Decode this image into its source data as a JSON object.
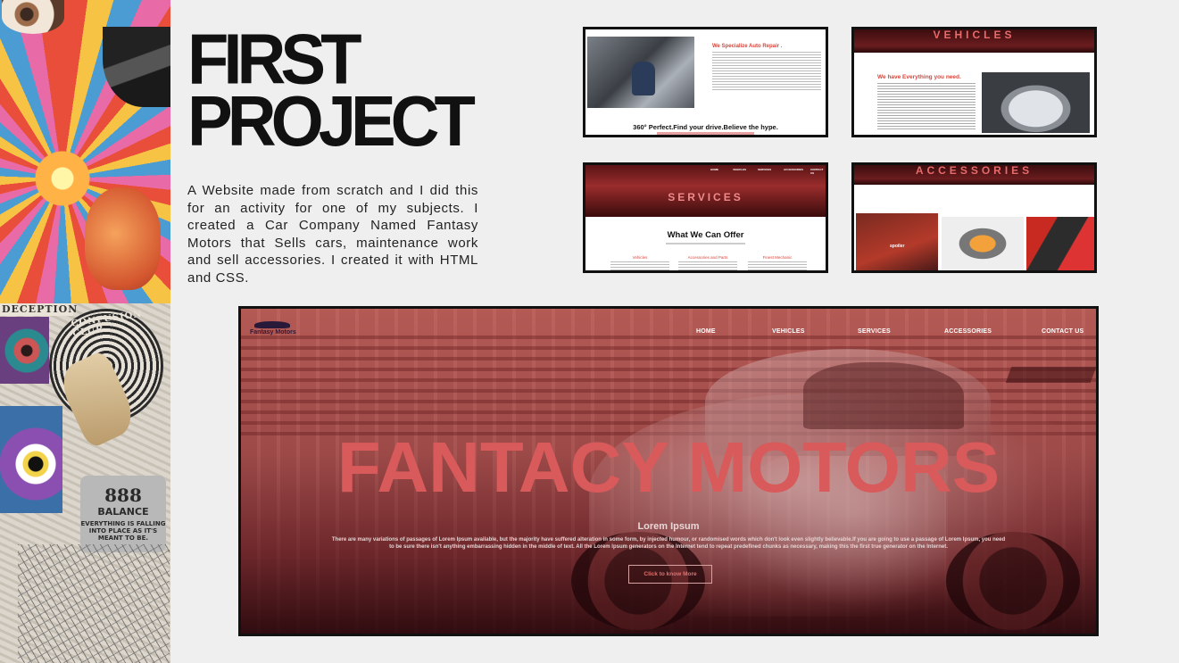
{
  "slide": {
    "title_line1": "FIRST",
    "title_line2": "PROJECT",
    "description": "A Website made from scratch and I did this for an activity for one of my subjects. I created a Car Company Named Fantasy Motors that Sells cars, maintenance work and sell accessories. I created it with HTML and CSS."
  },
  "collage": {
    "deception_label": "DECEPTION",
    "club_label": "CONFUSION CLUB",
    "balance_number": "888",
    "balance_label": "BALANCE",
    "balance_small": "EVERYTHING IS FALLING INTO PLACE AS IT'S MEANT TO BE."
  },
  "thumb1": {
    "heading": "We Specialize Auto Repair .",
    "tagline": "360° Perfect.Find your drive.Believe the hype."
  },
  "thumb2": {
    "banner": "VEHICLES",
    "heading": "We have Everything you need."
  },
  "thumb3": {
    "nav": [
      "HOME",
      "VEHICLES",
      "SERVICES",
      "ACCESSORIES",
      "CONTACT US"
    ],
    "banner": "SERVICES",
    "heading": "What We Can Offer",
    "columns": [
      "Vehicles",
      "Accessories and Parts",
      "Finest Mechanic"
    ]
  },
  "thumb4": {
    "banner": "ACCESSORIES",
    "card1_label": "spoiler"
  },
  "hero": {
    "logo_text": "Fantasy Motors",
    "nav": [
      "HOME",
      "VEHICLES",
      "SERVICES",
      "ACCESSORIES",
      "CONTACT US"
    ],
    "title": "FANTACY MOTORS",
    "subheading": "Lorem Ipsum",
    "paragraph": "There are many variations of passages of Lorem Ipsum available, but the majority have suffered alteration in some form, by injected humour, or randomised words which don't look even slightly believable.If you are going to use a passage of Lorem Ipsum, you need to be sure there isn't anything embarrassing hidden in the middle of text. All the Lorem Ipsum generators on the Internet tend to repeat predefined chunks as necessary, making this the first true generator on the Internet.",
    "cta_label": "Click to know More"
  },
  "colors": {
    "accent_red": "#d85a5a",
    "dark_maroon": "#3b0d0f",
    "background": "#efefef"
  }
}
